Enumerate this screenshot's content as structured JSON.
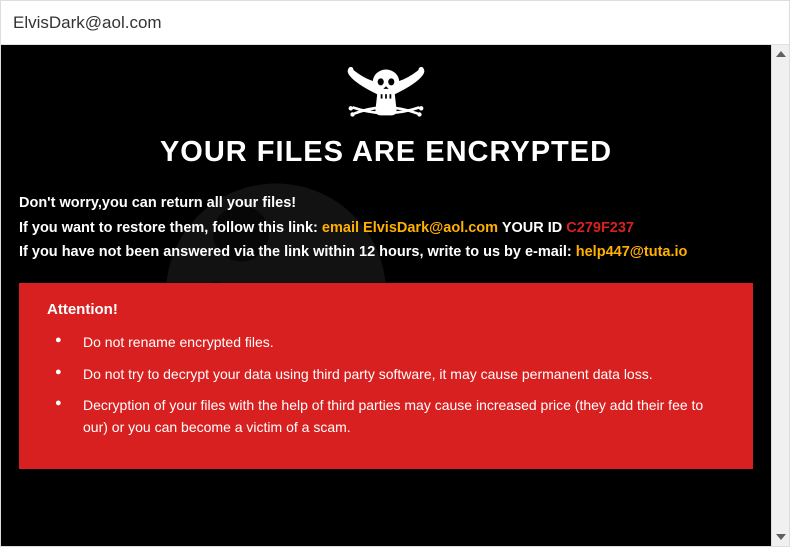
{
  "window": {
    "title": "ElvisDark@aol.com"
  },
  "main": {
    "heading": "YOUR FILES ARE ENCRYPTED",
    "line1": "Don't worry,you can return all your files!",
    "line2_pre": "If you want to restore them, follow this link: ",
    "line2_email_label": "email ElvisDark@aol.com",
    "line2_mid": "   YOUR ID ",
    "line2_id": "C279F237",
    "line3_pre": "If you have not been answered via the link within 12 hours, write to us by e-mail: ",
    "line3_email": "help447@tuta.io"
  },
  "attention": {
    "title": "Attention!",
    "items": [
      "Do not rename encrypted files.",
      "Do not try to decrypt your data using third party software, it may cause permanent data loss.",
      "Decryption of your files with the help of third parties may cause increased price (they add their fee to our) or you can become a victim of a scam."
    ]
  }
}
